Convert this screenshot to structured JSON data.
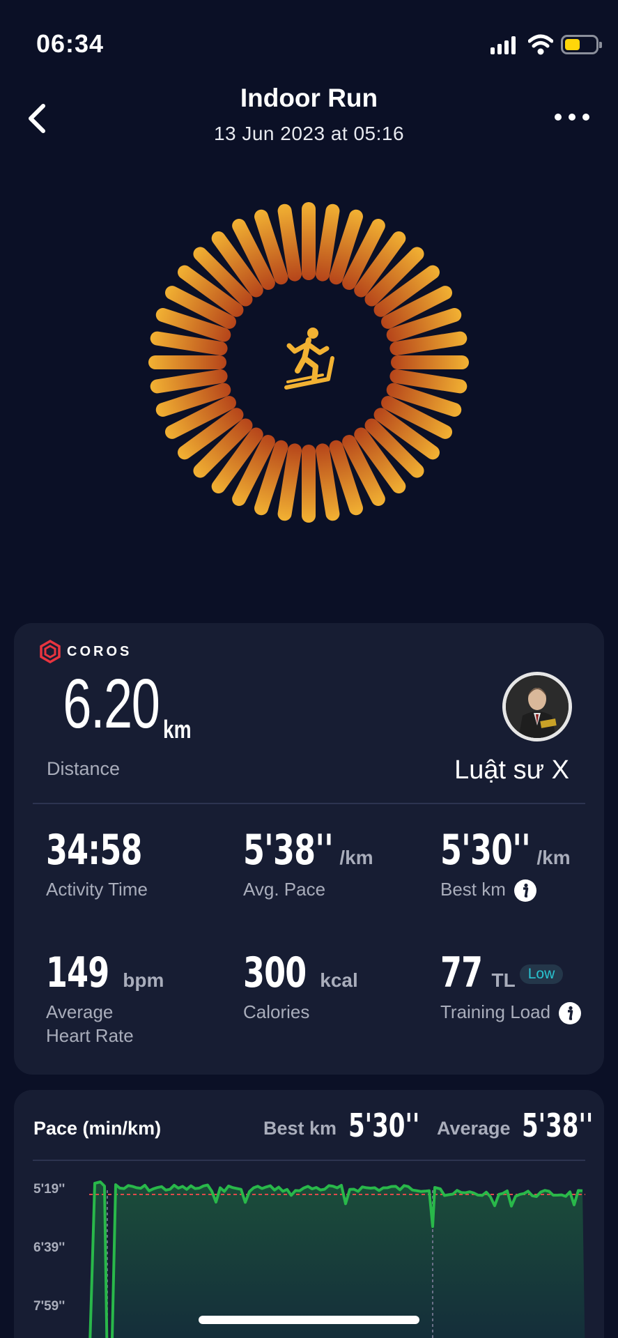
{
  "status_bar": {
    "time": "06:34",
    "battery_level": 0.5
  },
  "nav": {
    "title": "Indoor Run",
    "subtitle": "13 Jun 2023 at 05:16"
  },
  "hero": {
    "icon": "treadmill-run-icon",
    "colors": {
      "outer": "#f2b233",
      "inner": "#b5441a"
    }
  },
  "summary": {
    "brand": "COROS",
    "distance": {
      "value": "6.20",
      "unit": "km",
      "label": "Distance"
    },
    "user": {
      "name": "Luật sư X"
    },
    "stats": [
      {
        "value": "34:58",
        "unit": "",
        "label": "Activity Time"
      },
      {
        "value": "5'38''",
        "unit": "/km",
        "label": "Avg. Pace"
      },
      {
        "value": "5'30''",
        "unit": "/km",
        "label": "Best km",
        "info": true
      },
      {
        "value": "149",
        "unit": "bpm",
        "label": "Average\nHeart Rate"
      },
      {
        "value": "300",
        "unit": "kcal",
        "label": "Calories"
      },
      {
        "value": "77",
        "unit": "TL",
        "badge": "Low",
        "label": "Training Load",
        "info": true
      }
    ]
  },
  "pace_chart": {
    "title": "Pace (min/km)",
    "best_label": "Best km",
    "best_value": "5'30''",
    "avg_label": "Average",
    "avg_value": "5'38''",
    "y_ticks": [
      "5'19''",
      "6'39''",
      "7'59''"
    ],
    "colors": {
      "line": "#29b84a",
      "fill": "#1b4d3a",
      "avg_line": "#e04a4a"
    }
  }
}
